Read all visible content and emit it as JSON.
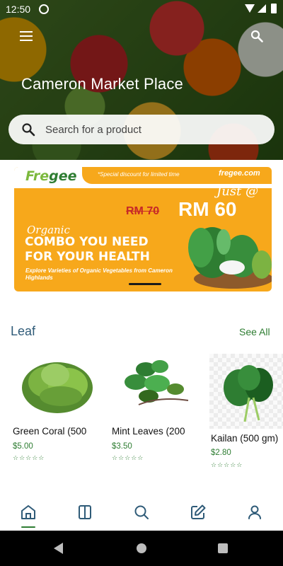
{
  "status_bar": {
    "time": "12:50"
  },
  "hero": {
    "title": "Cameron Market Place",
    "search_placeholder": "Search for a product"
  },
  "banner": {
    "logo_part1": "Fre",
    "logo_part2": "gee",
    "special_text": "*Special discount for limited time",
    "site": "fregee.com",
    "just_text": "Just @",
    "old_price": "RM 70",
    "new_price": "RM 60",
    "organic_word": "Organic",
    "headline_line1": "COMBO YOU NEED",
    "headline_line2": "FOR YOUR HEALTH",
    "subtext": "Explore Varieties of Organic Vegetables from Cameron Highlands"
  },
  "section": {
    "title": "Leaf",
    "see_all": "See All"
  },
  "products": [
    {
      "name": "Green Coral (500",
      "price": "$5.00",
      "rating": 0,
      "stars": "☆☆☆☆☆",
      "image_icon": "lettuce"
    },
    {
      "name": "Mint Leaves (200",
      "price": "$3.50",
      "rating": 0,
      "stars": "☆☆☆☆☆",
      "image_icon": "mint"
    },
    {
      "name": "Kailan (500 gm)",
      "price": "$2.80",
      "rating": 0,
      "stars": "☆☆☆☆☆",
      "image_icon": "kailan"
    }
  ],
  "bottom_nav": {
    "items": [
      "home-icon",
      "book-icon",
      "search-icon",
      "edit-icon",
      "profile-icon"
    ],
    "active": "home-icon"
  },
  "colors": {
    "accent_green": "#2e7d32",
    "banner_orange": "#f7a81b",
    "section_title_blue": "#2f5b78"
  }
}
